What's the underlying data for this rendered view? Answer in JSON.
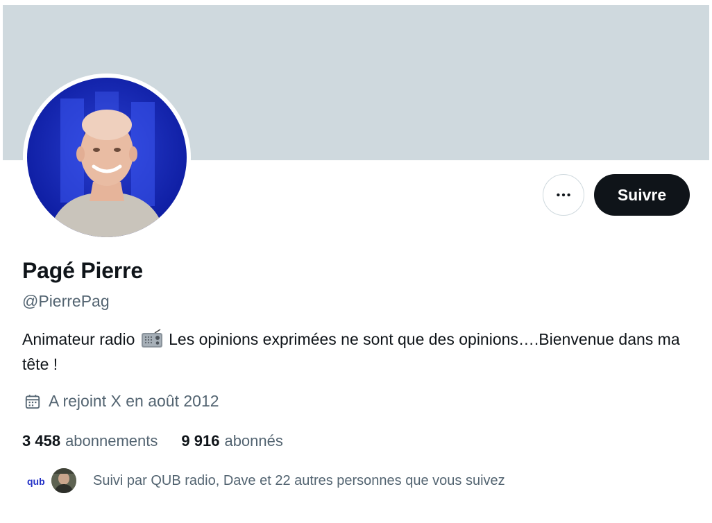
{
  "profile": {
    "name": "Pagé Pierre",
    "handle": "@PierrePag",
    "bio_before": "Animateur radio ",
    "bio_icon": "radio-icon",
    "bio_after": " Les opinions exprimées ne sont que des opinions….Bienvenue dans ma tête !",
    "joined": "A rejoint X en août 2012"
  },
  "actions": {
    "more_icon": "more-horizontal-icon",
    "follow_label": "Suivre"
  },
  "stats": {
    "following_count": "3 458",
    "following_label": "abonnements",
    "followers_count": "9 916",
    "followers_label": "abonnés"
  },
  "followed_by": {
    "text": "Suivi par QUB radio, Dave et 22 autres personnes que vous suivez",
    "avatars": [
      {
        "name": "qub-radio-avatar",
        "logo_text": "qub"
      },
      {
        "name": "dave-avatar"
      }
    ]
  },
  "colors": {
    "banner": "#cfd9de",
    "primary_text": "#0f1419",
    "secondary_text": "#536471",
    "follow_button": "#0f1419",
    "avatar_blue": "#1a2fb8"
  }
}
